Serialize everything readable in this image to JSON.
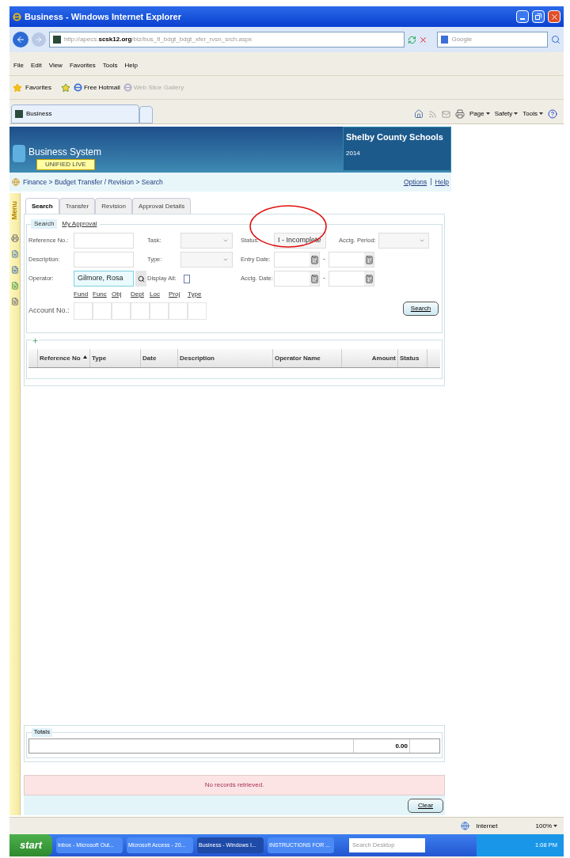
{
  "browser": {
    "title": "Business - Windows Internet Explorer",
    "address": {
      "prefix": "http://apecs.",
      "domain": "scsk12.org",
      "path": "/biz/bus_fi_bdgt_bdgt_xfer_rvsn_srch.aspx"
    },
    "search_placeholder": "Google",
    "menu": [
      "File",
      "Edit",
      "View",
      "Favorites",
      "Tools",
      "Help"
    ],
    "favorites_label": "Favorites",
    "favorite_links": [
      {
        "label": "Free Hotmail",
        "disabled": false
      },
      {
        "label": "Web Slice Gallery",
        "disabled": true
      }
    ],
    "tab": "Business",
    "commands": [
      "Page",
      "Safety",
      "Tools"
    ]
  },
  "header": {
    "app_name": "Business System",
    "environment": "UNIFIED LIVE",
    "organization": "Shelby County Schools",
    "year": "2014"
  },
  "breadcrumb": "Finance > Budget Transfer / Revision > Search",
  "header_links": [
    "Options",
    "Help"
  ],
  "header_link_separator": "|",
  "side_menu": "Menu",
  "tabs": [
    {
      "label": "Search",
      "selected": true
    },
    {
      "label": "Transfer",
      "selected": false
    },
    {
      "label": "Revision",
      "selected": false
    },
    {
      "label": "Approval Details",
      "selected": false
    }
  ],
  "subtabs": [
    {
      "label": "Search",
      "selected": true
    },
    {
      "label": "My Approval",
      "selected": false
    }
  ],
  "form": {
    "rows": [
      [
        {
          "kind": "text",
          "label": "Reference No.:"
        },
        {
          "kind": "select",
          "label": "Task:"
        },
        {
          "kind": "select",
          "label": "Status:",
          "value": "I - Incomplete"
        },
        {
          "kind": "select",
          "label": "Acctg. Period:"
        }
      ],
      [
        {
          "kind": "text",
          "label": "Description:"
        },
        {
          "kind": "select",
          "label": "Type:"
        },
        {
          "kind": "date_range",
          "label": "Entry Date:",
          "separator": "-"
        }
      ],
      [
        {
          "kind": "lookup",
          "label": "Operator:",
          "value": "Gilmore, Rosa"
        },
        {
          "kind": "checkbox",
          "label": "Display All:",
          "checked": false
        },
        {
          "kind": "date_range",
          "label": "Acctg. Date:",
          "separator": "-"
        }
      ]
    ],
    "account_label": "Account No.:",
    "account_segments": [
      "Fund",
      "Func",
      "Obj",
      "Dept",
      "Loc",
      "Proj",
      "Type"
    ],
    "search_button": "Search"
  },
  "results": {
    "columns": [
      {
        "label": "Reference No",
        "sorted": true
      },
      {
        "label": "Type",
        "sorted": false
      },
      {
        "label": "Date",
        "sorted": false
      },
      {
        "label": "Description",
        "sorted": false
      },
      {
        "label": "Operator Name",
        "sorted": false
      },
      {
        "label": "Amount",
        "sorted": false
      },
      {
        "label": "Status",
        "sorted": false
      }
    ]
  },
  "totals": {
    "title": "Totals",
    "amount": "0.00"
  },
  "message": "No records retrieved.",
  "clear_button": "Clear",
  "status_bar": {
    "zone": "Internet",
    "zoom": "100%"
  },
  "taskbar": {
    "start": "start",
    "items": [
      {
        "label": "Inbox - Microsoft Out...",
        "selected": false
      },
      {
        "label": "Microsoft Access - 20...",
        "selected": false
      },
      {
        "label": "Business - Windows I...",
        "selected": true
      },
      {
        "label": "INSTRUCTIONS FOR ...",
        "selected": false
      }
    ],
    "search_placeholder": "Search Desktop",
    "clock": "1:08 PM"
  }
}
